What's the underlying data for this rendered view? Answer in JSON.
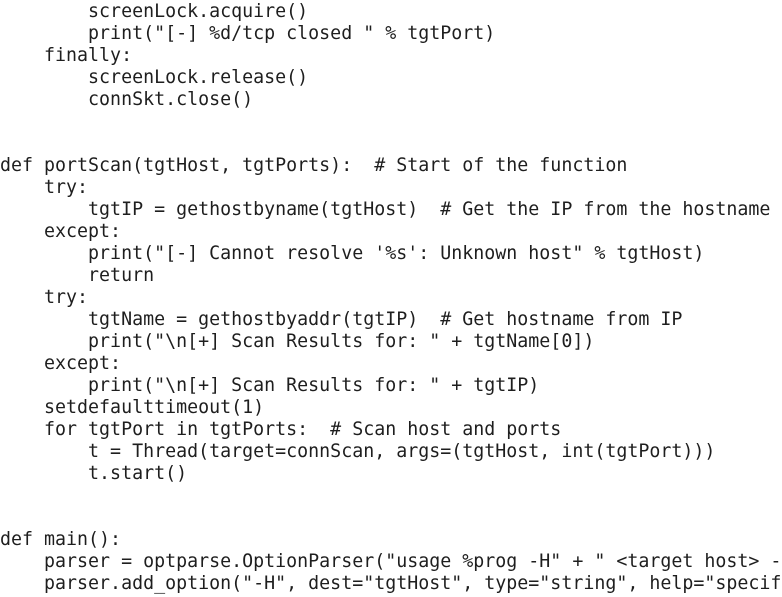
{
  "code": {
    "lines": [
      "        screenLock.acquire()",
      "        print(\"[-] %d/tcp closed \" % tgtPort)",
      "    finally:",
      "        screenLock.release()",
      "        connSkt.close()",
      "",
      "",
      "def portScan(tgtHost, tgtPorts):  # Start of the function",
      "    try:",
      "        tgtIP = gethostbyname(tgtHost)  # Get the IP from the hostname",
      "    except:",
      "        print(\"[-] Cannot resolve '%s': Unknown host\" % tgtHost)",
      "        return",
      "    try:",
      "        tgtName = gethostbyaddr(tgtIP)  # Get hostname from IP",
      "        print(\"\\n[+] Scan Results for: \" + tgtName[0])",
      "    except:",
      "        print(\"\\n[+] Scan Results for: \" + tgtIP)",
      "    setdefaulttimeout(1)",
      "    for tgtPort in tgtPorts:  # Scan host and ports",
      "        t = Thread(target=connScan, args=(tgtHost, int(tgtPort)))",
      "        t.start()",
      "",
      "",
      "def main():",
      "    parser = optparse.OptionParser(\"usage %prog -H\" + \" <target host> -",
      "    parser.add_option(\"-H\", dest=\"tgtHost\", type=\"string\", help=\"specif"
    ]
  },
  "colors": {
    "text": "#1e1e1e",
    "background": "#ffffff"
  }
}
